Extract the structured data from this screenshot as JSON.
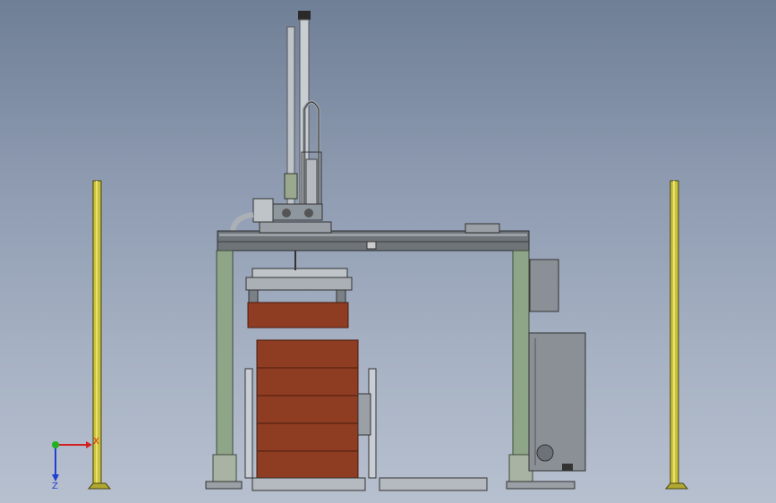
{
  "viewport": {
    "background_top": "#6f7f96",
    "background_bottom": "#b7c0cf"
  },
  "colors": {
    "frame": "#8fa588",
    "frame_edge": "#3f4a3c",
    "beam": "#6e7478",
    "guard_post": "#c9c23a",
    "carton": "#8e3d22",
    "carton_edge": "#4a1c0e",
    "steel": "#c9ced4",
    "cabinet": "#8a9096"
  },
  "triad": {
    "x_label": "X",
    "z_label": "Z",
    "x_color": "#d22020",
    "z_color": "#1f3fd0",
    "y_color": "#20b020"
  },
  "cartons": {
    "stack_count": 5,
    "held_count": 1
  }
}
